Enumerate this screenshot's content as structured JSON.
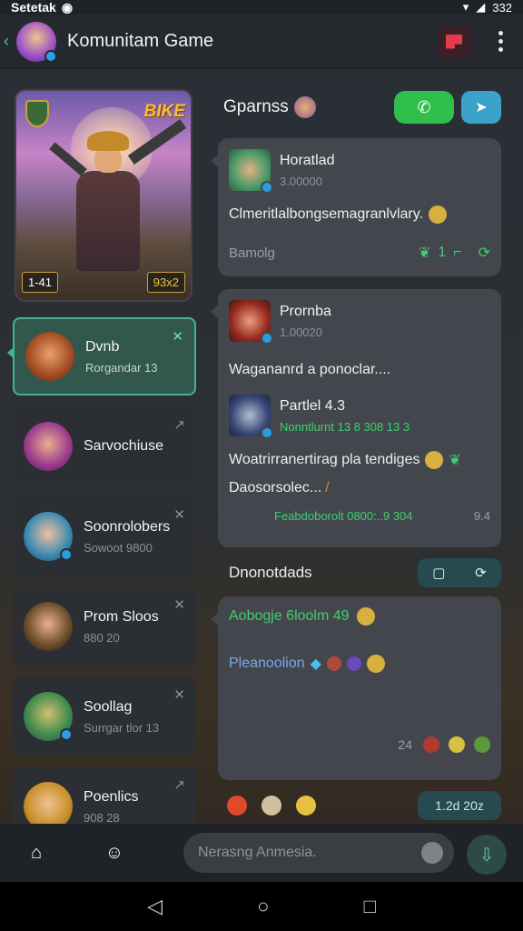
{
  "status": {
    "left": "Setetak",
    "right": "332"
  },
  "header": {
    "title": "Komunitam Game"
  },
  "hero": {
    "title": "BIKE",
    "tag_left": "1-41",
    "tag_right": "93x2"
  },
  "contacts": [
    {
      "name": "Dvnb",
      "sub": "Rorgandar 13",
      "x": "✕"
    },
    {
      "name": "Sarvochiuse",
      "sub": "",
      "x": "↗"
    },
    {
      "name": "Soonrolobers",
      "sub": "Sowoot 9800",
      "x": "✕"
    },
    {
      "name": "Prom Sloos",
      "sub": "880 20",
      "x": "✕"
    },
    {
      "name": "Soollag",
      "sub": "Surrgar tlor 13",
      "x": "✕"
    },
    {
      "name": "Poenlics",
      "sub": "908 28",
      "x": "↗"
    }
  ],
  "group": {
    "title": "Gparnss"
  },
  "cards": [
    {
      "name": "Horatlad",
      "time": "3.00000",
      "message": "Clmeritlalbongsemagranlvlary.",
      "footer_left": "Bamolg",
      "footer_count": "1"
    },
    {
      "name": "Prornba",
      "time": "1.00020",
      "message": "Wagananrd a ponoclar....",
      "sub_name": "Partlel 4.3",
      "sub_time": "Nonntlurnt 13 8 308 13 3",
      "message2": "Woatrirranertirag pla tendiges",
      "message2b": "Daosorsolec...",
      "footer_link": "Feabdoborolt 0800:..9 304",
      "footer_right": "9.4"
    }
  ],
  "thread": {
    "title": "Dnonotdads"
  },
  "card3": {
    "line1": "Aobogje 6loolm 49",
    "line2": "Pleanoolion",
    "count": "24"
  },
  "reactions": {
    "pill": "1.2d 20z"
  },
  "composer": {
    "placeholder": "Nerasng Anmesia."
  }
}
